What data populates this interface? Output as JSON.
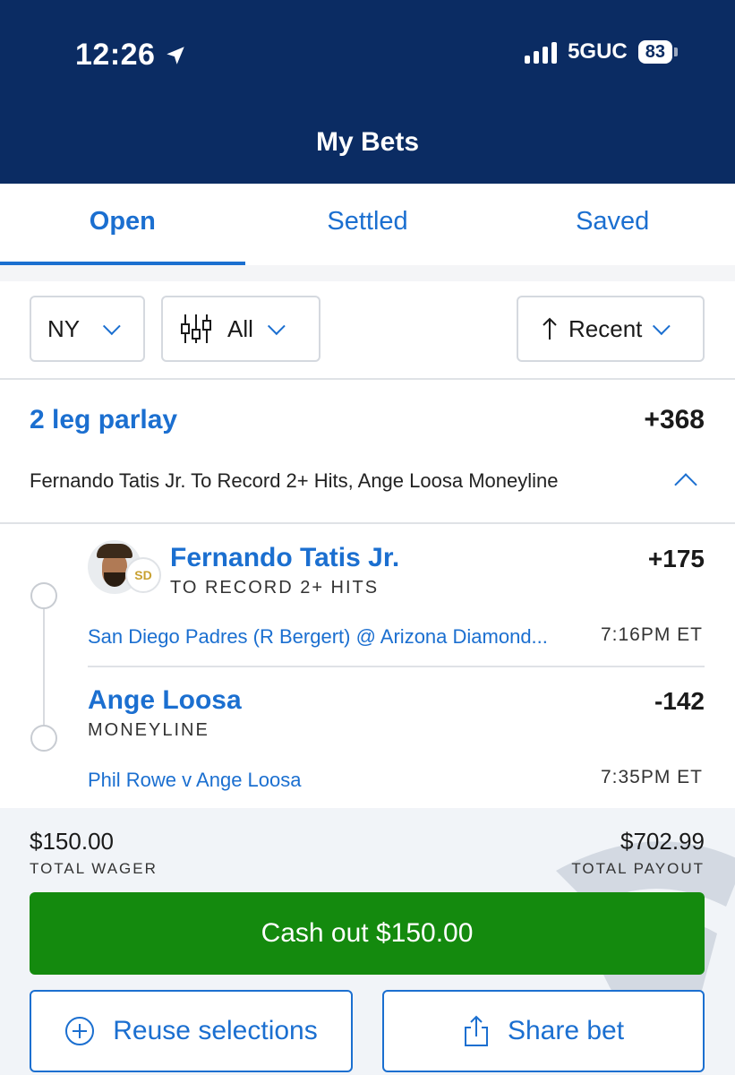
{
  "status_bar": {
    "time": "12:26",
    "network": "5GUC",
    "battery": "83"
  },
  "header": {
    "title": "My Bets"
  },
  "tabs": [
    {
      "label": "Open",
      "active": true
    },
    {
      "label": "Settled",
      "active": false
    },
    {
      "label": "Saved",
      "active": false
    }
  ],
  "filters": {
    "state": "NY",
    "type": "All",
    "sort": "Recent"
  },
  "parlay": {
    "title": "2 leg parlay",
    "odds": "+368",
    "description": "Fernando Tatis Jr. To Record 2+ Hits, Ange Loosa Moneyline",
    "legs": [
      {
        "name": "Fernando Tatis Jr.",
        "market": "TO RECORD 2+ HITS",
        "odds": "+175",
        "event": "San Diego Padres (R Bergert) @ Arizona Diamond...",
        "time": "7:16PM ET",
        "team_logo": "SD"
      },
      {
        "name": "Ange Loosa",
        "market": "MONEYLINE",
        "odds": "-142",
        "event": "Phil Rowe v Ange Loosa",
        "time": "7:35PM ET"
      }
    ]
  },
  "totals": {
    "wager_amount": "$150.00",
    "wager_label": "TOTAL WAGER",
    "payout_amount": "$702.99",
    "payout_label": "TOTAL PAYOUT"
  },
  "actions": {
    "cashout": "Cash out $150.00",
    "reuse": "Reuse selections",
    "share": "Share bet"
  },
  "colors": {
    "header_bg": "#0b2c63",
    "accent": "#1b6fd0",
    "cashout": "#148a0e"
  }
}
